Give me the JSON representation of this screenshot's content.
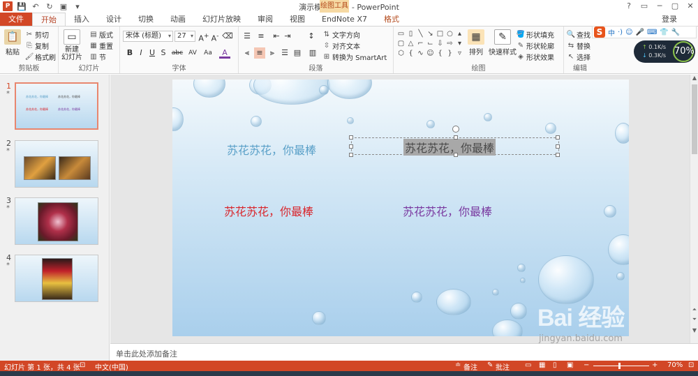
{
  "window": {
    "title": "演示模板.pptx - PowerPoint",
    "context_tab_header": "绘图工具",
    "controls": [
      "?",
      "▭",
      "─",
      "▢",
      "✕"
    ]
  },
  "tabs": {
    "file": "文件",
    "items": [
      "开始",
      "插入",
      "设计",
      "切换",
      "动画",
      "幻灯片放映",
      "审阅",
      "视图",
      "EndNote X7"
    ],
    "context": "格式",
    "login": "登录"
  },
  "ribbon": {
    "clipboard": {
      "paste": "粘贴",
      "cut": "剪切",
      "copy": "复制",
      "format_painter": "格式刷",
      "label": "剪贴板"
    },
    "slides": {
      "new_slide": "新建\n幻灯片",
      "layout": "版式",
      "reset": "重置",
      "section": "节",
      "label": "幻灯片"
    },
    "font": {
      "font_name": "宋体 (标题)",
      "font_size": "27",
      "label": "字体",
      "buttons": [
        "B",
        "I",
        "U",
        "S",
        "abc",
        "AV",
        "Aa",
        "A"
      ]
    },
    "paragraph": {
      "text_direction": "文字方向",
      "align_text": "对齐文本",
      "convert_smartart": "转换为 SmartArt",
      "label": "段落"
    },
    "drawing": {
      "arrange": "排列",
      "quick_styles": "快速样式",
      "shape_fill": "形状填充",
      "shape_outline": "形状轮廓",
      "shape_effects": "形状效果",
      "label": "绘图"
    },
    "editing": {
      "find": "查找",
      "replace": "替换",
      "select": "选择",
      "label": "编辑"
    }
  },
  "ime_toolbar": {
    "logo": "S",
    "items": [
      "中",
      "·)",
      "☺",
      "🎤",
      "⌨",
      "👕",
      "🔧"
    ]
  },
  "net_widget": {
    "up": "0.1K/s",
    "down": "0.3K/s",
    "percent": "70%"
  },
  "thumbnails": [
    {
      "num": "1",
      "star": "*",
      "active": true
    },
    {
      "num": "2",
      "star": "*",
      "active": false
    },
    {
      "num": "3",
      "star": "*",
      "active": false
    },
    {
      "num": "4",
      "star": "*",
      "active": false
    }
  ],
  "slide": {
    "texts": [
      {
        "text": "苏花苏花，你最棒",
        "color": "#5aa0c8"
      },
      {
        "text": "苏花苏花，你最棒",
        "color": "#555555"
      },
      {
        "text": "苏花苏花，你最棒",
        "color": "#d9262c"
      },
      {
        "text": "苏花苏花，你最棒",
        "color": "#7a3aa0"
      }
    ],
    "thumb_texts": [
      "苏花苏花，你最棒",
      "苏花苏花，你最棒",
      "苏花苏花，你最棒",
      "苏花苏花，你最棒"
    ]
  },
  "notes": {
    "placeholder": "单击此处添加备注"
  },
  "watermark": {
    "brand": "Bai  经验",
    "url": "jingyan.baidu.com"
  },
  "statusbar": {
    "slide_info": "幻灯片 第 1 张，共 4 张",
    "language": "中文(中国)",
    "notes": "备注",
    "comments": "批注",
    "zoom": "70%"
  },
  "colors": {
    "accent": "#d24726",
    "selection_highlight": "#9a9a9a"
  }
}
